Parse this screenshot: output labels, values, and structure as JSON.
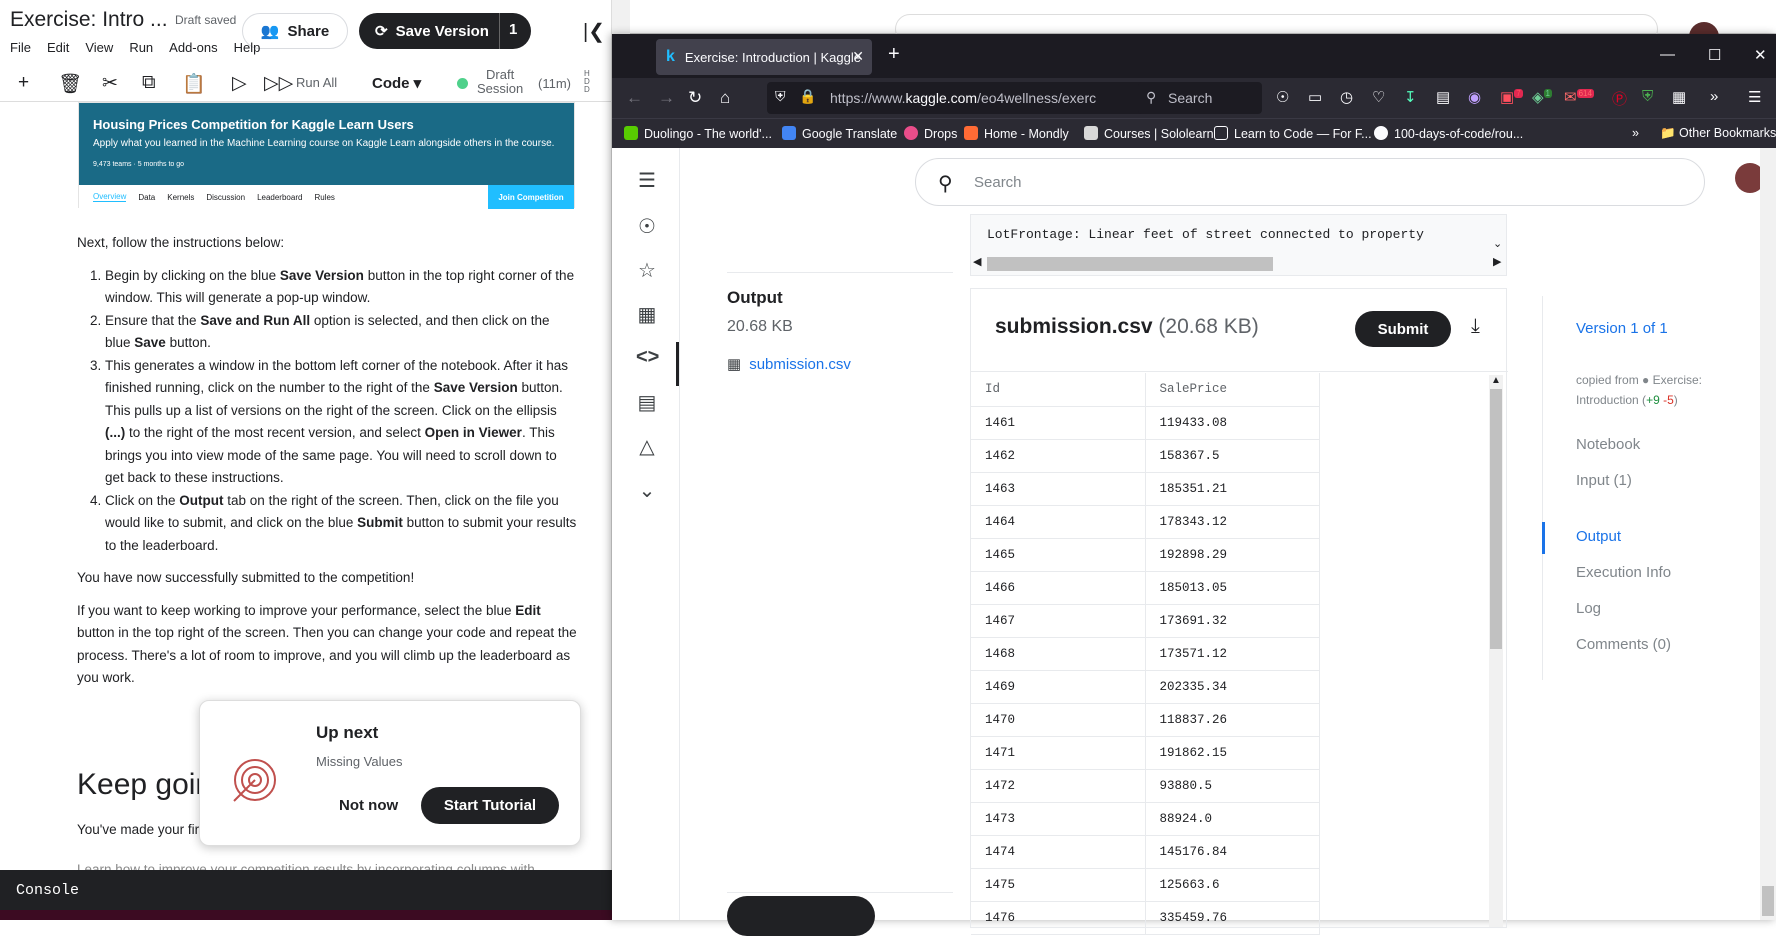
{
  "notebook": {
    "title": "Exercise: Intro ...",
    "draft_status": "Draft saved",
    "share_label": "Share",
    "save_version_label": "Save Version",
    "version_count": "1",
    "menu": [
      "File",
      "Edit",
      "View",
      "Run",
      "Add-ons",
      "Help"
    ],
    "run_all_label": "Run All",
    "cell_type": "Code",
    "session_label_1": "Draft",
    "session_label_2": "Session",
    "session_time": "(11m)",
    "banner": {
      "title": "Housing Prices Competition for Kaggle Learn Users",
      "description": "Apply what you learned in the Machine Learning course on Kaggle Learn alongside others in the course.",
      "meta": "9,473 teams · 5 months to go",
      "tabs": [
        "Overview",
        "Data",
        "Kernels",
        "Discussion",
        "Leaderboard",
        "Rules"
      ],
      "join_label": "Join Competition"
    },
    "intro": "Next, follow the instructions below:",
    "steps": [
      [
        "Begin by clicking on the blue ",
        "Save Version",
        " button in the top right corner of the window. This will generate a pop-up window."
      ],
      [
        "Ensure that the ",
        "Save and Run All",
        " option is selected, and then click on the blue ",
        "Save",
        " button."
      ],
      [
        "This generates a window in the bottom left corner of the notebook. After it has finished running, click on the number to the right of the ",
        "Save Version",
        " button. This pulls up a list of versions on the right of the screen. Click on the ellipsis ",
        "(...)",
        " to the right of the most recent version, and select ",
        "Open in Viewer",
        ". This brings you into view mode of the same page. You will need to scroll down to get back to these instructions."
      ],
      [
        "Click on the ",
        "Output",
        " tab on the right of the screen. Then, click on the file you would like to submit, and click on the blue ",
        "Submit",
        " button to submit your results to the leaderboard."
      ]
    ],
    "success": "You have now successfully submitted to the competition!",
    "keep_working": [
      "If you want to keep working to improve your performance, select the blue ",
      "Edit",
      " button in the top right of the screen. Then you can change your code and repeat the process. There's a lot of room to improve, and you will climb up the leaderboard as you work."
    ],
    "keep_going_heading": "Keep goin",
    "youve_made": "You've made your fir",
    "faded_line": "Learn how to improve your competition results by incorporating columns with",
    "console_label": "Console"
  },
  "up_next": {
    "title": "Up next",
    "subtitle": "Missing Values",
    "not_now": "Not now",
    "start": "Start Tutorial"
  },
  "browser": {
    "tab_title": "Exercise: Introduction | Kaggle",
    "url_prefix": "https://www.",
    "url_domain": "kaggle.com",
    "url_path": "/eo4wellness/exerc",
    "search_placeholder": "Search",
    "badges": {
      "a": "7",
      "b": "1",
      "c": "614"
    },
    "bookmarks": [
      {
        "label": "Duolingo - The world'...",
        "color": "#58cc02"
      },
      {
        "label": "Google Translate",
        "color": "#4285f4"
      },
      {
        "label": "Drops",
        "color": "#e94d8a"
      },
      {
        "label": "Home - Mondly",
        "color": "#ff6b35"
      },
      {
        "label": "Courses | Sololearn",
        "color": "#d8d8d8"
      },
      {
        "label": "Learn to Code — For F...",
        "color": "#1c1b22"
      },
      {
        "label": "100-days-of-code/rou...",
        "color": "#1c1b22"
      }
    ],
    "other_bookmarks": "Other Bookmarks"
  },
  "kaggle": {
    "search_placeholder": "Search",
    "code_preview": "LotFrontage: Linear feet of street connected to property",
    "output_heading": "Output",
    "output_size": "20.68 KB",
    "output_file": "submission.csv",
    "file_name": "submission.csv",
    "file_size": "(20.68 KB)",
    "submit_label": "Submit",
    "table": {
      "headers": [
        "Id",
        "SalePrice"
      ],
      "rows": [
        [
          "1461",
          "119433.08"
        ],
        [
          "1462",
          "158367.5"
        ],
        [
          "1463",
          "185351.21"
        ],
        [
          "1464",
          "178343.12"
        ],
        [
          "1465",
          "192898.29"
        ],
        [
          "1466",
          "185013.05"
        ],
        [
          "1467",
          "173691.32"
        ],
        [
          "1468",
          "173571.12"
        ],
        [
          "1469",
          "202335.34"
        ],
        [
          "1470",
          "118837.26"
        ],
        [
          "1471",
          "191862.15"
        ],
        [
          "1472",
          "93880.5"
        ],
        [
          "1473",
          "88924.0"
        ],
        [
          "1474",
          "145176.84"
        ],
        [
          "1475",
          "125663.6"
        ],
        [
          "1476",
          "335459.76"
        ]
      ]
    },
    "version_label": "Version 1 of 1",
    "copied_from_prefix": "copied from",
    "copied_from_name": "Exercise: Introduction",
    "diff_pos": "+9",
    "diff_neg": "-5",
    "right_nav": [
      "Notebook",
      "Input (1)",
      "Output",
      "Execution Info",
      "Log",
      "Comments (0)"
    ],
    "active_nav": "Output"
  }
}
